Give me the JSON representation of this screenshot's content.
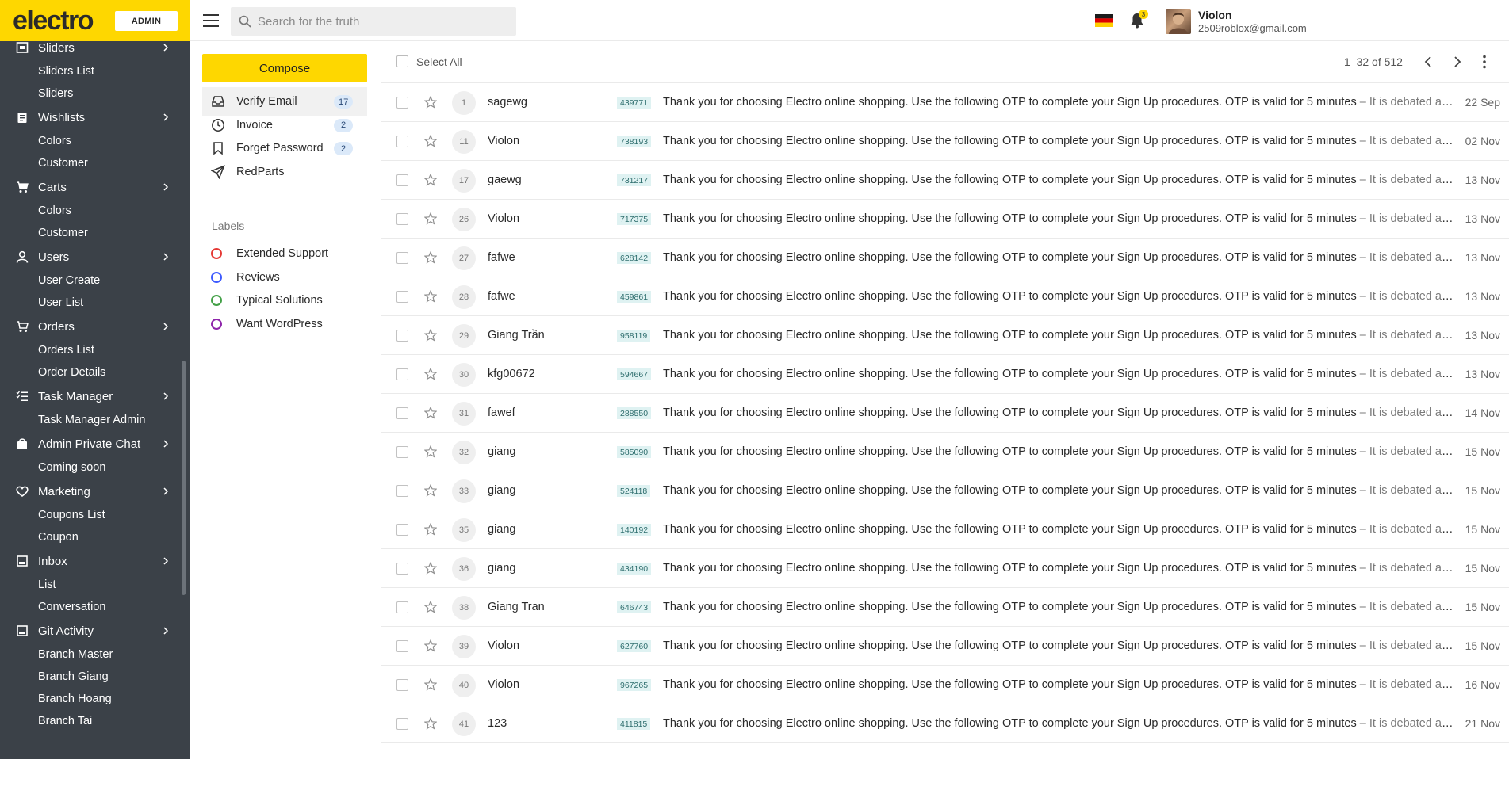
{
  "brand": {
    "logo": "electro",
    "badge": "ADMIN"
  },
  "search": {
    "placeholder": "Search for the truth",
    "value": ""
  },
  "notifications": {
    "count": "3"
  },
  "user": {
    "name": "Violon",
    "email": "2509roblox@gmail.com"
  },
  "sidebar": {
    "groups": [
      {
        "label": "Sliders",
        "icon": "slider-icon",
        "children": [
          "Sliders List",
          "Sliders"
        ]
      },
      {
        "label": "Wishlists",
        "icon": "clipboard-icon",
        "children": [
          "Colors",
          "Customer"
        ]
      },
      {
        "label": "Carts",
        "icon": "cart-icon",
        "children": [
          "Colors",
          "Customer"
        ]
      },
      {
        "label": "Users",
        "icon": "user-icon",
        "children": [
          "User Create",
          "User List"
        ]
      },
      {
        "label": "Orders",
        "icon": "cart-outline-icon",
        "children": [
          "Orders List",
          "Order Details"
        ]
      },
      {
        "label": "Task Manager",
        "icon": "task-list-icon",
        "children": [
          "Task Manager Admin"
        ]
      },
      {
        "label": "Admin Private Chat",
        "icon": "bag-icon",
        "children": [
          "Coming soon"
        ]
      },
      {
        "label": "Marketing",
        "icon": "heart-icon",
        "children": [
          "Coupons List",
          "Coupon"
        ]
      },
      {
        "label": "Inbox",
        "icon": "inbox-icon",
        "children": [
          "List",
          "Conversation"
        ]
      },
      {
        "label": "Git Activity",
        "icon": "monitor-icon",
        "children": [
          "Branch Master",
          "Branch Giang",
          "Branch Hoang",
          "Branch Tai"
        ]
      }
    ]
  },
  "mail": {
    "compose_label": "Compose",
    "folders": [
      {
        "label": "Verify Email",
        "count": "17",
        "icon": "inbox-tray-icon",
        "active": true
      },
      {
        "label": "Invoice",
        "count": "2",
        "icon": "clock-icon",
        "active": false
      },
      {
        "label": "Forget Password",
        "count": "2",
        "icon": "bookmark-icon",
        "active": false
      },
      {
        "label": "RedParts",
        "count": "",
        "icon": "send-icon",
        "active": false
      }
    ],
    "labels_title": "Labels",
    "labels": [
      {
        "label": "Extended Support",
        "color": "#e53935"
      },
      {
        "label": "Reviews",
        "color": "#3d5afe"
      },
      {
        "label": "Typical Solutions",
        "color": "#43a047"
      },
      {
        "label": "Want WordPress",
        "color": "#8e24aa"
      }
    ],
    "toolbar": {
      "select_all": "Select All",
      "pagination": "1–32 of 512"
    },
    "message_text": "Thank you for choosing Electro online shopping. Use the following OTP to complete your Sign Up procedures. OTP is valid for 5 minutes",
    "preview_text": " – It is debated as to whether there is an official answer to this question",
    "rows": [
      {
        "num": "1",
        "sender": "sagewg",
        "code": "439771",
        "date": "22 Sep"
      },
      {
        "num": "11",
        "sender": "Violon",
        "code": "738193",
        "date": "02 Nov"
      },
      {
        "num": "17",
        "sender": "gaewg",
        "code": "731217",
        "date": "13 Nov"
      },
      {
        "num": "26",
        "sender": "Violon",
        "code": "717375",
        "date": "13 Nov"
      },
      {
        "num": "27",
        "sender": "fafwe",
        "code": "628142",
        "date": "13 Nov"
      },
      {
        "num": "28",
        "sender": "fafwe",
        "code": "459861",
        "date": "13 Nov"
      },
      {
        "num": "29",
        "sender": "Giang Trần",
        "code": "958119",
        "date": "13 Nov"
      },
      {
        "num": "30",
        "sender": "kfg00672",
        "code": "594667",
        "date": "13 Nov"
      },
      {
        "num": "31",
        "sender": "fawef",
        "code": "288550",
        "date": "14 Nov"
      },
      {
        "num": "32",
        "sender": "giang",
        "code": "585090",
        "date": "15 Nov"
      },
      {
        "num": "33",
        "sender": "giang",
        "code": "524118",
        "date": "15 Nov"
      },
      {
        "num": "35",
        "sender": "giang",
        "code": "140192",
        "date": "15 Nov"
      },
      {
        "num": "36",
        "sender": "giang",
        "code": "434190",
        "date": "15 Nov"
      },
      {
        "num": "38",
        "sender": "Giang Tran",
        "code": "646743",
        "date": "15 Nov"
      },
      {
        "num": "39",
        "sender": "Violon",
        "code": "627760",
        "date": "15 Nov"
      },
      {
        "num": "40",
        "sender": "Violon",
        "code": "967265",
        "date": "16 Nov"
      },
      {
        "num": "41",
        "sender": "123",
        "code": "411815",
        "date": "21 Nov"
      }
    ]
  },
  "colors": {
    "accent": "#fed700",
    "sidebar_bg": "#3b4148"
  }
}
